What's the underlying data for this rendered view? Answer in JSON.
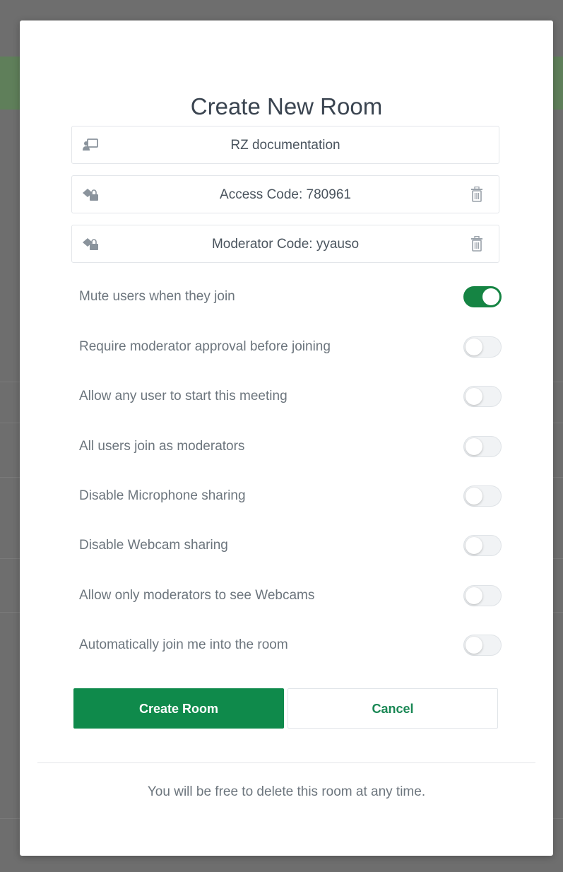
{
  "modal": {
    "title": "Create New Room",
    "fields": [
      {
        "icon": "room-name-icon",
        "value": "RZ documentation",
        "deletable": false
      },
      {
        "icon": "key-icon",
        "value": "Access Code: 780961",
        "deletable": true
      },
      {
        "icon": "key-icon",
        "value": "Moderator Code: yyauso",
        "deletable": true
      }
    ],
    "options": [
      {
        "label": "Mute users when they join",
        "enabled": true
      },
      {
        "label": "Require moderator approval before joining",
        "enabled": false
      },
      {
        "label": "Allow any user to start this meeting",
        "enabled": false
      },
      {
        "label": "All users join as moderators",
        "enabled": false
      },
      {
        "label": "Disable Microphone sharing",
        "enabled": false
      },
      {
        "label": "Disable Webcam sharing",
        "enabled": false
      },
      {
        "label": "Allow only moderators to see Webcams",
        "enabled": false
      },
      {
        "label": "Automatically join me into the room",
        "enabled": false
      }
    ],
    "buttons": {
      "create": "Create Room",
      "cancel": "Cancel"
    },
    "footer": "You will be free to delete this room at any time."
  },
  "colors": {
    "accent": "#158443",
    "primary_button": "#0f8a4b",
    "text": "#6c757d",
    "title": "#3a4450"
  }
}
